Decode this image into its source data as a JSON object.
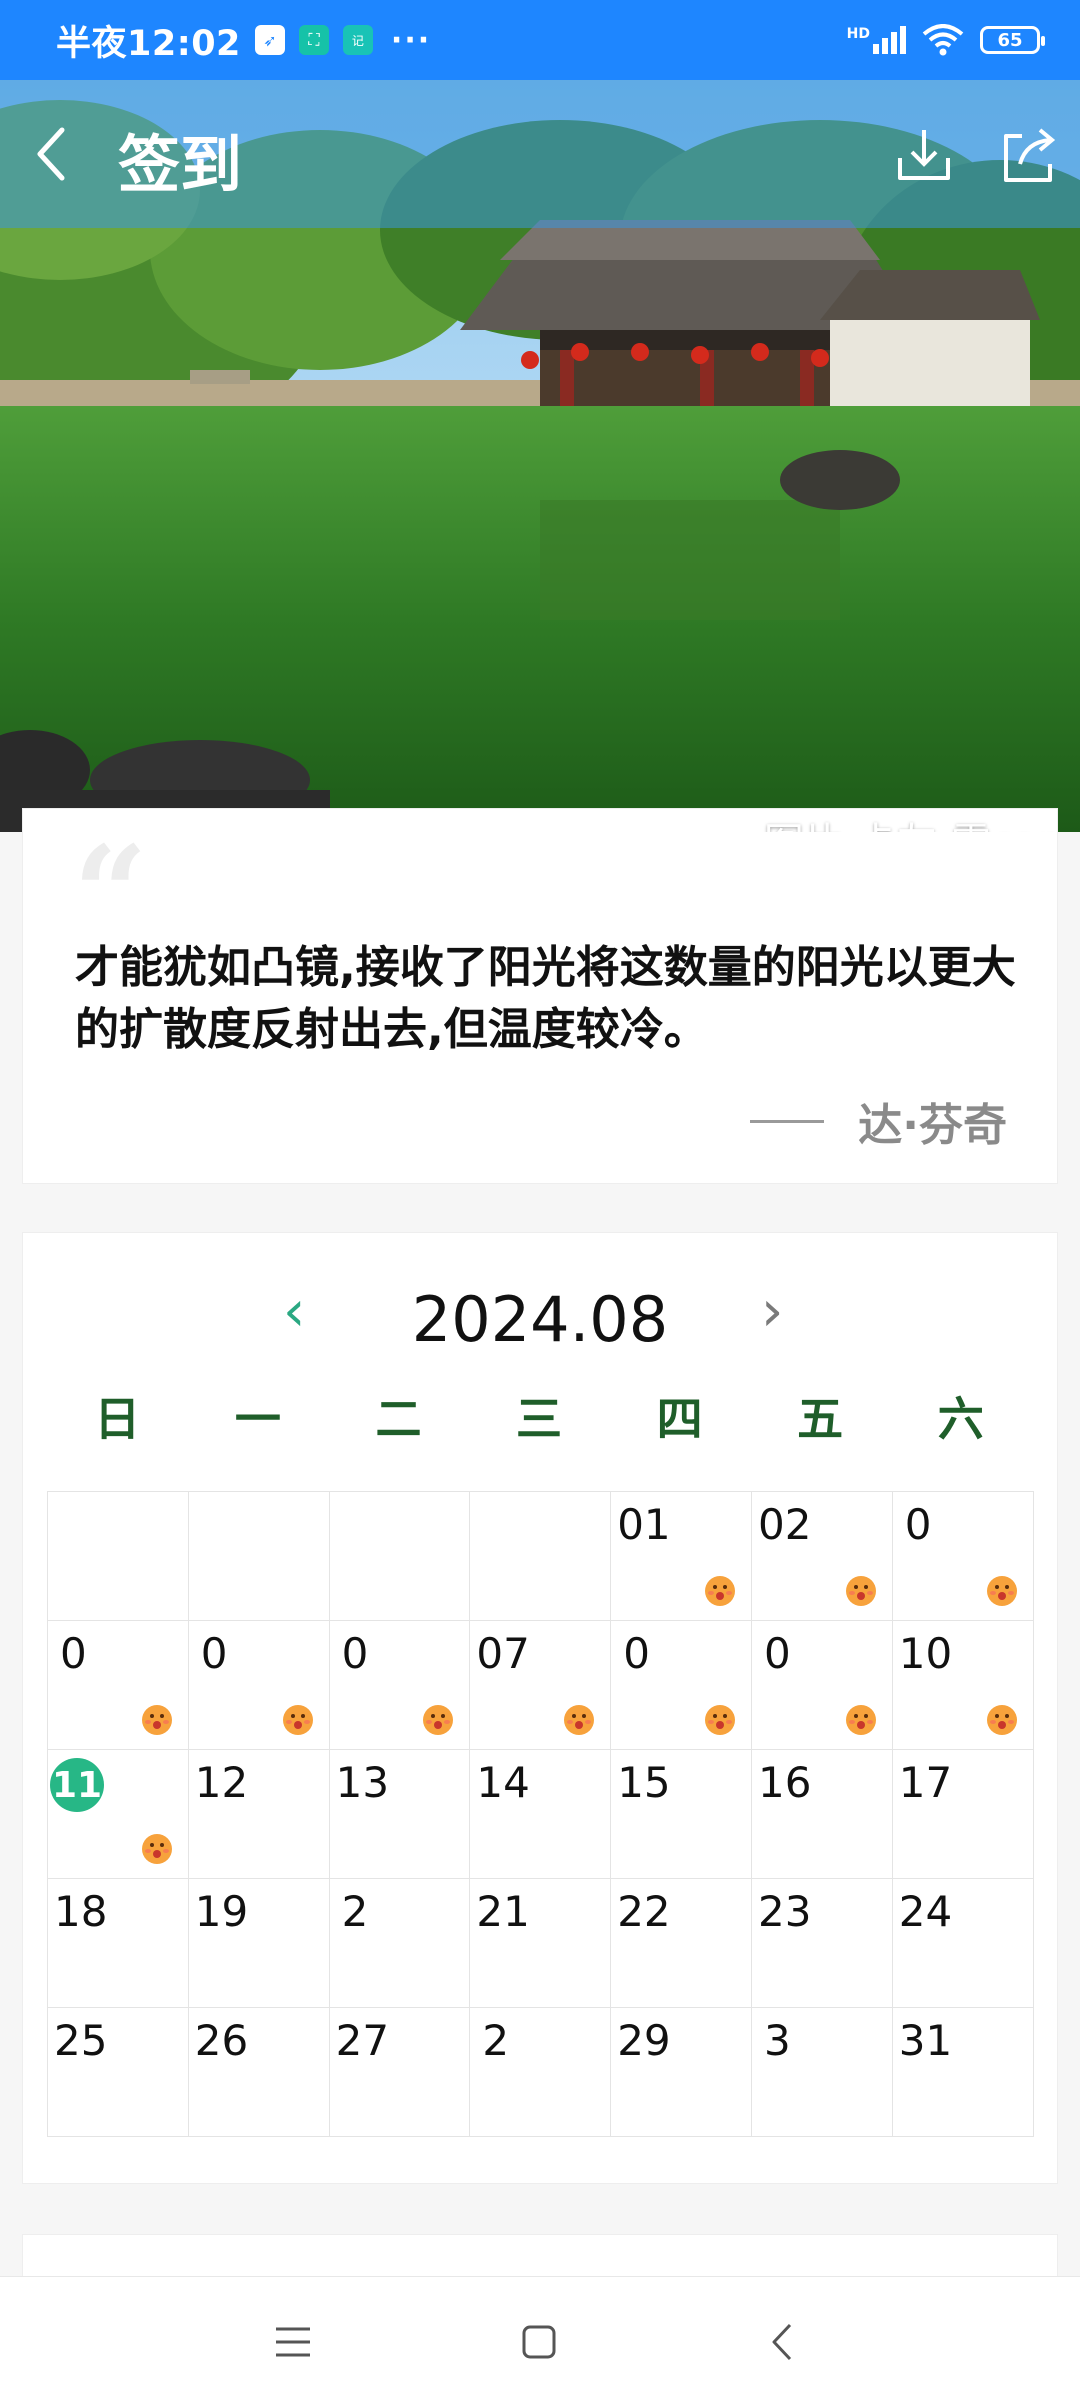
{
  "status_bar": {
    "time": "半夜12:02",
    "apps": [
      {
        "icon": "navigation-app-icon",
        "glyph": "➶"
      },
      {
        "icon": "scan-app-icon",
        "glyph": "⛶"
      },
      {
        "icon": "notes-app-icon",
        "glyph": "记"
      }
    ],
    "more": "···",
    "network": "HD",
    "battery": "65"
  },
  "header": {
    "title": "签到",
    "back_icon": "back-icon",
    "download_icon": "download-icon",
    "share_icon": "share-icon"
  },
  "hero": {
    "credit": "图片 卡友-雷car"
  },
  "quote": {
    "mark": "“",
    "text": "才能犹如凸镜,接收了阳光将这数量的阳光以更大的扩散度反射出去,但温度较冷。",
    "dash": "——",
    "author": "达·芬奇"
  },
  "calendar": {
    "month": "2024.08",
    "prev": "‹",
    "next": "›",
    "weekdays": [
      "日",
      "一",
      "二",
      "三",
      "四",
      "五",
      "六"
    ],
    "weeks": [
      [
        {
          "day": ""
        },
        {
          "day": ""
        },
        {
          "day": ""
        },
        {
          "day": ""
        },
        {
          "day": "01",
          "signed": true
        },
        {
          "day": "02",
          "signed": true
        },
        {
          "day": "0",
          "signed": true
        }
      ],
      [
        {
          "day": "0",
          "signed": true
        },
        {
          "day": "0",
          "signed": true
        },
        {
          "day": "0",
          "signed": true
        },
        {
          "day": "07",
          "signed": true
        },
        {
          "day": "0",
          "signed": true
        },
        {
          "day": "0",
          "signed": true
        },
        {
          "day": "10",
          "signed": true
        }
      ],
      [
        {
          "day": "11",
          "signed": true,
          "today": true
        },
        {
          "day": "12"
        },
        {
          "day": "13"
        },
        {
          "day": "14"
        },
        {
          "day": "15"
        },
        {
          "day": "16"
        },
        {
          "day": "17"
        }
      ],
      [
        {
          "day": "18"
        },
        {
          "day": "19"
        },
        {
          "day": "2"
        },
        {
          "day": "21"
        },
        {
          "day": "22"
        },
        {
          "day": "23"
        },
        {
          "day": "24"
        }
      ],
      [
        {
          "day": "25"
        },
        {
          "day": "26"
        },
        {
          "day": "27"
        },
        {
          "day": "2"
        },
        {
          "day": "29"
        },
        {
          "day": "3"
        },
        {
          "day": "31"
        }
      ]
    ],
    "accent": "#27b786",
    "weekday_color": "#1f5e2a"
  },
  "nav_bar": {
    "menu_icon": "menu-icon",
    "home_icon": "home-icon",
    "back_icon": "back-nav-icon"
  }
}
